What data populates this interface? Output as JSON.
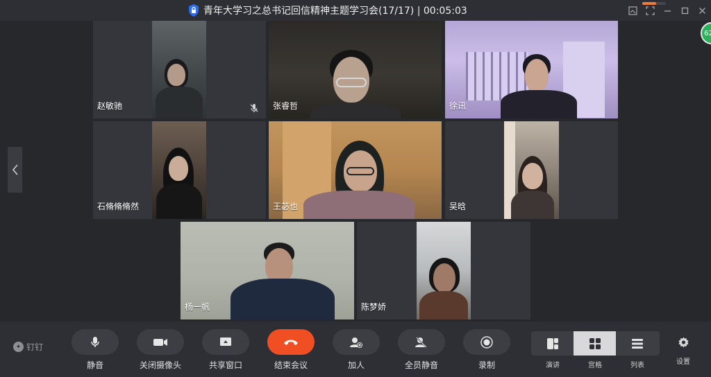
{
  "window": {
    "title": "青年大学习之总书记回信精神主题学习会(17/17) | 00:05:03"
  },
  "participants": [
    {
      "name": "赵敏驰",
      "muted": true
    },
    {
      "name": "张睿哲",
      "muted": false
    },
    {
      "name": "徐讯",
      "muted": false
    },
    {
      "name": "石脩脩脩然",
      "muted": false
    },
    {
      "name": "王苾也",
      "muted": false
    },
    {
      "name": "吴晗",
      "muted": false
    },
    {
      "name": "杨一帆",
      "muted": false
    },
    {
      "name": "陈梦娇",
      "muted": false
    }
  ],
  "badge": {
    "text": "62"
  },
  "brand": {
    "name": "钉钉"
  },
  "toolbar": {
    "mute_label": "静音",
    "camera_label": "关闭摄像头",
    "share_label": "共享窗口",
    "end_label": "结束会议",
    "join_label": "加人",
    "mute_all_label": "全员静音",
    "record_label": "录制"
  },
  "views": {
    "speaker_label": "演讲",
    "grid_label": "宫格",
    "list_label": "列表",
    "active": "宫格"
  },
  "settings": {
    "label": "设置"
  },
  "colors": {
    "end_call": "#f04e23",
    "accent": "#2a6ef5",
    "badge": "#27b35a"
  }
}
